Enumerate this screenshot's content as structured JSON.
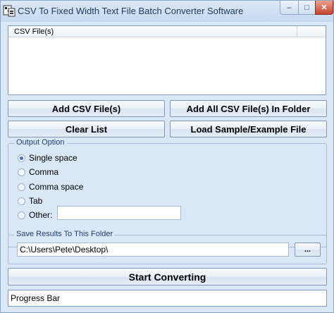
{
  "window": {
    "title": "CSV To Fixed Width Text File Batch Converter Software",
    "app_icon": "app-logo-icon",
    "controls": {
      "minimize": "–",
      "maximize": "□",
      "close": "✕"
    }
  },
  "file_list": {
    "column_header": "CSV File(s)",
    "rows": []
  },
  "buttons": {
    "add_csv": "Add CSV File(s)",
    "add_all": "Add All CSV File(s) In Folder",
    "clear_list": "Clear List",
    "load_sample": "Load Sample/Example File",
    "start": "Start Converting",
    "browse": "..."
  },
  "output_option": {
    "title": "Output Option",
    "options": [
      {
        "label": "Single space",
        "checked": true
      },
      {
        "label": "Comma",
        "checked": false
      },
      {
        "label": "Comma space",
        "checked": false
      },
      {
        "label": "Tab",
        "checked": false
      },
      {
        "label": "Other:",
        "checked": false
      }
    ],
    "other_value": ""
  },
  "save_folder": {
    "title": "Save Results To This Folder",
    "path": "C:\\Users\\Pete\\Desktop\\"
  },
  "progress": {
    "label": "Progress Bar"
  },
  "colors": {
    "background": "#d9e7f7",
    "group_title": "#1f3f75",
    "border": "#7f9db9"
  }
}
